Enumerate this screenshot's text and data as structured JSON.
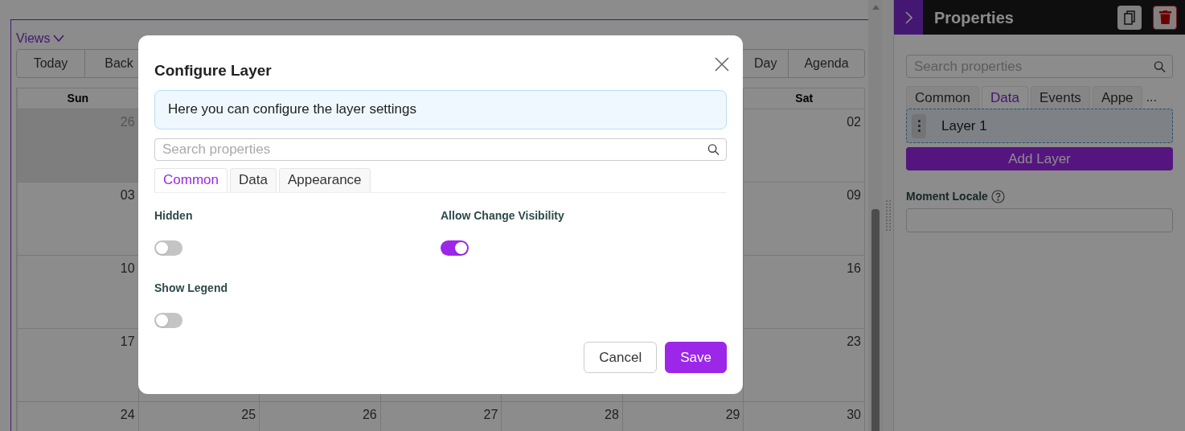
{
  "calendar": {
    "views_label": "Views",
    "toolbar_left": [
      "Today",
      "Back"
    ],
    "toolbar_right": [
      "Day",
      "Agenda"
    ],
    "weekday_headers": [
      "Sun",
      "Sat"
    ],
    "weeks": [
      [
        {
          "day": "26",
          "outside": true
        },
        {
          "day": "02",
          "outside": false
        }
      ],
      [
        {
          "day": "03",
          "outside": false
        },
        {
          "day": "09",
          "outside": false
        }
      ],
      [
        {
          "day": "10",
          "outside": false
        },
        {
          "day": "16",
          "outside": false
        }
      ],
      [
        {
          "day": "17",
          "outside": false
        },
        {
          "day": "23",
          "outside": false
        }
      ],
      [
        {
          "day": "24",
          "outside": false
        },
        {
          "day": "25",
          "outside": false
        },
        {
          "day": "26",
          "outside": false
        },
        {
          "day": "27",
          "outside": false
        },
        {
          "day": "28",
          "outside": false
        },
        {
          "day": "29",
          "outside": false
        },
        {
          "day": "30",
          "outside": false
        }
      ]
    ]
  },
  "properties_panel": {
    "title": "Properties",
    "search": {
      "placeholder": "Search properties"
    },
    "tabs": [
      {
        "label": "Common",
        "selected": false
      },
      {
        "label": "Data",
        "selected": true
      },
      {
        "label": "Events",
        "selected": false
      },
      {
        "label": "Appe",
        "selected": false
      }
    ],
    "more": "...",
    "layers": [
      {
        "label": "Layer 1"
      }
    ],
    "add_button": "Add Layer",
    "fields": [
      {
        "label": "Moment Locale"
      }
    ]
  },
  "dialog": {
    "title": "Configure Layer",
    "info": "Here you can configure the layer settings",
    "search": {
      "placeholder": "Search properties"
    },
    "tabs": [
      {
        "label": "Common",
        "selected": true
      },
      {
        "label": "Data",
        "selected": false
      },
      {
        "label": "Appearance",
        "selected": false
      }
    ],
    "toggles": [
      {
        "label": "Hidden",
        "on": false
      },
      {
        "label": "Allow Change Visibility",
        "on": true
      },
      {
        "label": "Show Legend",
        "on": false
      }
    ],
    "buttons": [
      {
        "label": "Cancel",
        "kind": "secondary"
      },
      {
        "label": "Save",
        "kind": "primary"
      }
    ]
  }
}
